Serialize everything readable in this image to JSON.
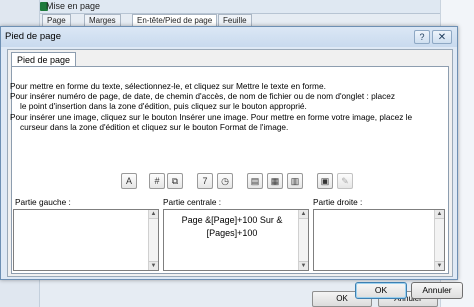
{
  "background": {
    "title": "Mise en page",
    "tabs": [
      "Page",
      "Marges",
      "En-tête/Pied de page",
      "Feuille"
    ],
    "ok_label": "OK",
    "cancel_label": "Annuler"
  },
  "dialog": {
    "title": "Pied de page",
    "help_label": "?",
    "close_label": "✕",
    "tab_label": "Pied de page",
    "instructions": [
      "Pour mettre en forme du texte, sélectionnez-le, et cliquez sur Mettre le texte en forme.",
      "Pour insérer numéro de page, de date, de chemin d'accès, de nom de fichier ou de nom d'onglet  : placez",
      "le point d'insertion dans la zone d'édition, puis cliquez sur le bouton approprié.",
      "Pour insérer une image, cliquez sur le bouton Insérer une image. Pour mettre en forme votre image, placez le",
      "curseur dans la zone d'édition et cliquez sur le bouton Format de l'image."
    ],
    "toolbar": [
      {
        "icon": "format-text-icon",
        "glyph": "A"
      },
      {
        "icon": "page-number-icon",
        "glyph": "#"
      },
      {
        "icon": "page-count-icon",
        "glyph": "⧉"
      },
      {
        "icon": "date-icon",
        "glyph": "7"
      },
      {
        "icon": "time-icon",
        "glyph": "◷"
      },
      {
        "icon": "file-path-icon",
        "glyph": "▤"
      },
      {
        "icon": "file-name-icon",
        "glyph": "▦"
      },
      {
        "icon": "sheet-name-icon",
        "glyph": "▥"
      },
      {
        "icon": "insert-picture-icon",
        "glyph": "▣"
      },
      {
        "icon": "format-picture-icon",
        "glyph": "✎"
      }
    ],
    "left_section_label": "Partie gauche :",
    "center_section_label": "Partie centrale :",
    "right_section_label": "Partie droite :",
    "center_text": "Page &[Page]+100 Sur &[Pages]+100",
    "ok_label": "OK",
    "cancel_label": "Annuler"
  },
  "colors": {
    "titlebar": "#c9daee",
    "dialog_bg": "#dfe9f5",
    "ok_border": "#3c7fb1"
  }
}
